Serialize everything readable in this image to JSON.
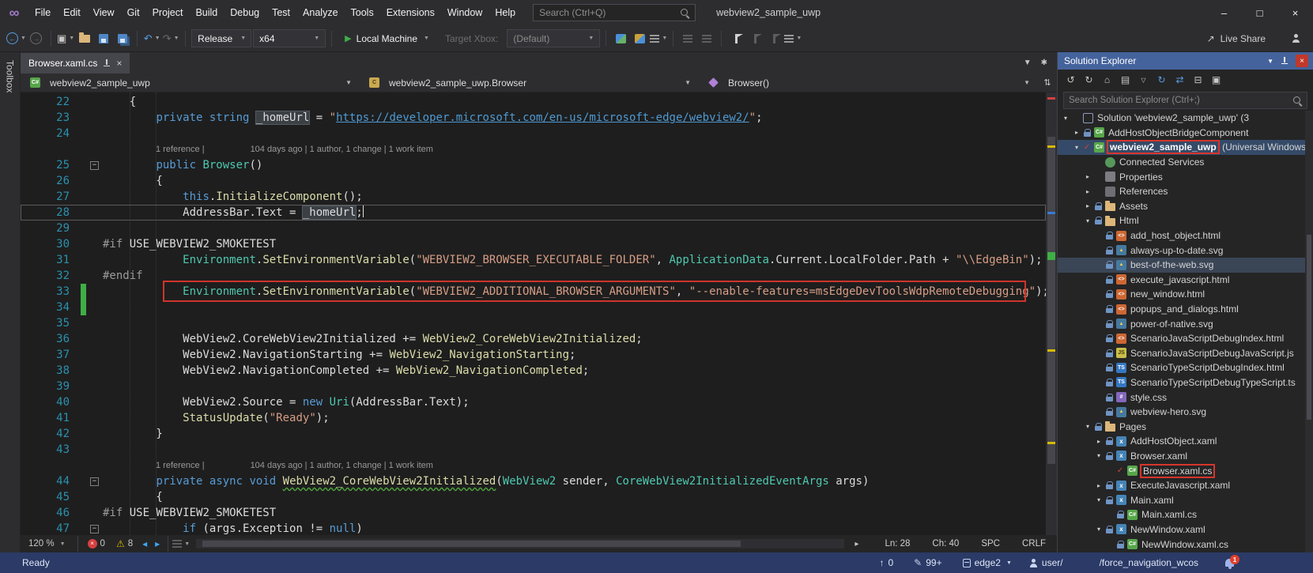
{
  "title_bar": {
    "menus": [
      "File",
      "Edit",
      "View",
      "Git",
      "Project",
      "Build",
      "Debug",
      "Test",
      "Analyze",
      "Tools",
      "Extensions",
      "Window",
      "Help"
    ],
    "search_placeholder": "Search (Ctrl+Q)",
    "window_title": "webview2_sample_uwp"
  },
  "toolbar": {
    "configuration": "Release",
    "platform": "x64",
    "start_button": "Local Machine",
    "target_xbox_label": "Target Xbox:",
    "device_dropdown": "(Default)",
    "live_share": "Live Share"
  },
  "toolbox_label": "Toolbox",
  "editor": {
    "tab_title": "Browser.xaml.cs",
    "nav_project": "webview2_sample_uwp",
    "nav_type": "webview2_sample_uwp.Browser",
    "nav_member": "Browser()",
    "codelens_left": "1 reference",
    "codelens_right": "104 days ago | 1 author, 1 change | 1 work item",
    "zoom": "120 %",
    "error_count": "0",
    "warning_count": "8",
    "line_indicator": "Ln: 28",
    "column_indicator": "Ch: 40",
    "space_indicator": "SPC",
    "eol_indicator": "CRLF",
    "code_lines": [
      {
        "n": "22",
        "segs": [
          [
            "pl",
            "    {"
          ]
        ]
      },
      {
        "n": "23",
        "segs": [
          [
            "pl",
            "        "
          ],
          [
            "kw",
            "private"
          ],
          [
            "pl",
            " "
          ],
          [
            "kw",
            "string"
          ],
          [
            "pl",
            " "
          ],
          [
            "ref",
            "_homeUrl"
          ],
          [
            "pl",
            " = "
          ],
          [
            "st",
            "\""
          ],
          [
            "url",
            "https://developer.microsoft.com/en-us/microsoft-edge/webview2/"
          ],
          [
            "st",
            "\""
          ],
          [
            "pl",
            ";"
          ]
        ]
      },
      {
        "n": "24",
        "segs": []
      },
      {
        "lens": true
      },
      {
        "n": "25",
        "fold": true,
        "segs": [
          [
            "pl",
            "        "
          ],
          [
            "kw",
            "public"
          ],
          [
            "pl",
            " "
          ],
          [
            "ty",
            "Browser"
          ],
          [
            "pl",
            "()"
          ]
        ]
      },
      {
        "n": "26",
        "segs": [
          [
            "pl",
            "        {"
          ]
        ]
      },
      {
        "n": "27",
        "segs": [
          [
            "pl",
            "            "
          ],
          [
            "kw",
            "this"
          ],
          [
            "pl",
            "."
          ],
          [
            "me",
            "InitializeComponent"
          ],
          [
            "pl",
            "();"
          ]
        ]
      },
      {
        "n": "28",
        "current": true,
        "caret": true,
        "segs": [
          [
            "pl",
            "            AddressBar.Text = "
          ],
          [
            "ref",
            "_homeUrl"
          ],
          [
            "pl",
            ";"
          ]
        ]
      },
      {
        "n": "29",
        "segs": []
      },
      {
        "n": "30",
        "segs": [
          [
            "pp",
            "#if"
          ],
          [
            "pl",
            " USE_WEBVIEW2_SMOKETEST"
          ]
        ]
      },
      {
        "n": "31",
        "segs": [
          [
            "pl",
            "            "
          ],
          [
            "ty",
            "Environment"
          ],
          [
            "pl",
            "."
          ],
          [
            "me",
            "SetEnvironmentVariable"
          ],
          [
            "pl",
            "("
          ],
          [
            "st",
            "\"WEBVIEW2_BROWSER_EXECUTABLE_FOLDER\""
          ],
          [
            "pl",
            ", "
          ],
          [
            "ty",
            "ApplicationData"
          ],
          [
            "pl",
            ".Current.LocalFolder.Path + "
          ],
          [
            "st",
            "\"\\\\EdgeBin\""
          ],
          [
            "pl",
            ");"
          ]
        ]
      },
      {
        "n": "32",
        "segs": [
          [
            "pp",
            "#endif"
          ]
        ]
      },
      {
        "n": "33",
        "changed": true,
        "annotated": true,
        "segs": [
          [
            "pl",
            "            "
          ],
          [
            "ty",
            "Environment"
          ],
          [
            "pl",
            "."
          ],
          [
            "me",
            "SetEnvironmentVariable"
          ],
          [
            "pl",
            "("
          ],
          [
            "st",
            "\"WEBVIEW2_ADDITIONAL_BROWSER_ARGUMENTS\""
          ],
          [
            "pl",
            ", "
          ],
          [
            "st",
            "\"--enable-features=msEdgeDevToolsWdpRemoteDebugging\""
          ],
          [
            "pl",
            ");"
          ]
        ]
      },
      {
        "n": "34",
        "changed": true,
        "segs": []
      },
      {
        "n": "35",
        "segs": []
      },
      {
        "n": "36",
        "segs": [
          [
            "pl",
            "            WebView2.CoreWebView2Initialized += "
          ],
          [
            "me",
            "WebView2_CoreWebView2Initialized"
          ],
          [
            "pl",
            ";"
          ]
        ]
      },
      {
        "n": "37",
        "segs": [
          [
            "pl",
            "            WebView2.NavigationStarting += "
          ],
          [
            "me",
            "WebView2_NavigationStarting"
          ],
          [
            "pl",
            ";"
          ]
        ]
      },
      {
        "n": "38",
        "segs": [
          [
            "pl",
            "            WebView2.NavigationCompleted += "
          ],
          [
            "me",
            "WebView2_NavigationCompleted"
          ],
          [
            "pl",
            ";"
          ]
        ]
      },
      {
        "n": "39",
        "segs": []
      },
      {
        "n": "40",
        "segs": [
          [
            "pl",
            "            WebView2.Source = "
          ],
          [
            "kw",
            "new"
          ],
          [
            "pl",
            " "
          ],
          [
            "ty",
            "Uri"
          ],
          [
            "pl",
            "(AddressBar.Text);"
          ]
        ]
      },
      {
        "n": "41",
        "segs": [
          [
            "pl",
            "            "
          ],
          [
            "me",
            "StatusUpdate"
          ],
          [
            "pl",
            "("
          ],
          [
            "st",
            "\"Ready\""
          ],
          [
            "pl",
            ");"
          ]
        ]
      },
      {
        "n": "42",
        "segs": [
          [
            "pl",
            "        }"
          ]
        ]
      },
      {
        "n": "43",
        "segs": []
      },
      {
        "lens": true
      },
      {
        "n": "44",
        "fold": true,
        "segs": [
          [
            "pl",
            "        "
          ],
          [
            "kw",
            "private"
          ],
          [
            "pl",
            " "
          ],
          [
            "kw",
            "async"
          ],
          [
            "pl",
            " "
          ],
          [
            "kw",
            "void"
          ],
          [
            "pl",
            " "
          ],
          [
            "mesq",
            "WebView2_CoreWebView2Initialized"
          ],
          [
            "pl",
            "("
          ],
          [
            "ty",
            "WebView2"
          ],
          [
            "pl",
            " sender, "
          ],
          [
            "ty",
            "CoreWebView2InitializedEventArgs"
          ],
          [
            "pl",
            " args)"
          ]
        ]
      },
      {
        "n": "45",
        "segs": [
          [
            "pl",
            "        {"
          ]
        ]
      },
      {
        "n": "46",
        "segs": [
          [
            "pp",
            "#if"
          ],
          [
            "pl",
            " USE_WEBVIEW2_SMOKETEST"
          ]
        ]
      },
      {
        "n": "47",
        "fold": true,
        "segs": [
          [
            "pl",
            "            "
          ],
          [
            "kw",
            "if"
          ],
          [
            "pl",
            " (args.Exception != "
          ],
          [
            "kw",
            "null"
          ],
          [
            "pl",
            ")"
          ]
        ]
      }
    ]
  },
  "solution_explorer": {
    "title": "Solution Explorer",
    "search_placeholder": "Search Solution Explorer (Ctrl+;)",
    "tree": [
      {
        "label": "Solution 'webview2_sample_uwp' (3",
        "icon": "solution",
        "indent": 0,
        "arrow": "open"
      },
      {
        "label": "AddHostObjectBridgeComponent",
        "icon": "csproj",
        "indent": 1,
        "arrow": "closed",
        "lock": true
      },
      {
        "label": "webview2_sample_uwp",
        "suffix": " (Universal Windows)",
        "icon": "csproj",
        "indent": 1,
        "arrow": "open",
        "check": true,
        "bold": true,
        "selected": true,
        "redbox": true
      },
      {
        "label": "Connected Services",
        "icon": "services",
        "indent": 2
      },
      {
        "label": "Properties",
        "icon": "properties",
        "indent": 2,
        "arrow": "closed"
      },
      {
        "label": "References",
        "icon": "references",
        "indent": 2,
        "arrow": "closed"
      },
      {
        "label": "Assets",
        "icon": "folder",
        "indent": 2,
        "arrow": "closed",
        "lock": true
      },
      {
        "label": "Html",
        "icon": "folder",
        "indent": 2,
        "arrow": "open",
        "lock": true
      },
      {
        "label": "add_host_object.html",
        "icon": "html",
        "indent": 3,
        "lock": true
      },
      {
        "label": "always-up-to-date.svg",
        "icon": "svg",
        "indent": 3,
        "lock": true
      },
      {
        "label": "best-of-the-web.svg",
        "icon": "svg",
        "indent": 3,
        "lock": true,
        "rowhl": true
      },
      {
        "label": "execute_javascript.html",
        "icon": "html",
        "indent": 3,
        "lock": true
      },
      {
        "label": "new_window.html",
        "icon": "html",
        "indent": 3,
        "lock": true
      },
      {
        "label": "popups_and_dialogs.html",
        "icon": "html",
        "indent": 3,
        "lock": true
      },
      {
        "label": "power-of-native.svg",
        "icon": "svg",
        "indent": 3,
        "lock": true
      },
      {
        "label": "ScenarioJavaScriptDebugIndex.html",
        "icon": "html",
        "indent": 3,
        "lock": true
      },
      {
        "label": "ScenarioJavaScriptDebugJavaScript.js",
        "icon": "js",
        "indent": 3,
        "lock": true
      },
      {
        "label": "ScenarioTypeScriptDebugIndex.html",
        "icon": "ts",
        "indent": 3,
        "lock": true
      },
      {
        "label": "ScenarioTypeScriptDebugTypeScript.ts",
        "icon": "ts",
        "indent": 3,
        "lock": true
      },
      {
        "label": "style.css",
        "icon": "css",
        "indent": 3,
        "lock": true
      },
      {
        "label": "webview-hero.svg",
        "icon": "svg",
        "indent": 3,
        "lock": true
      },
      {
        "label": "Pages",
        "icon": "folder",
        "indent": 2,
        "arrow": "open",
        "lock": true
      },
      {
        "label": "AddHostObject.xaml",
        "icon": "xaml",
        "indent": 3,
        "arrow": "closed",
        "lock": true
      },
      {
        "label": "Browser.xaml",
        "icon": "xaml",
        "indent": 3,
        "arrow": "open",
        "lock": true
      },
      {
        "label": "Browser.xaml.cs",
        "icon": "cs",
        "indent": 4,
        "check": true,
        "redbox": true
      },
      {
        "label": "ExecuteJavascript.xaml",
        "icon": "xaml",
        "indent": 3,
        "arrow": "closed",
        "lock": true
      },
      {
        "label": "Main.xaml",
        "icon": "xaml",
        "indent": 3,
        "arrow": "open",
        "lock": true
      },
      {
        "label": "Main.xaml.cs",
        "icon": "cs",
        "indent": 4,
        "lock": true
      },
      {
        "label": "NewWindow.xaml",
        "icon": "xaml",
        "indent": 3,
        "arrow": "open",
        "lock": true
      },
      {
        "label": "NewWindow.xaml.cs",
        "icon": "cs",
        "indent": 4,
        "lock": true
      }
    ]
  },
  "status_bar": {
    "ready": "Ready",
    "outgoing_commits": "0",
    "pending_edits": "99+",
    "repository": "edge2",
    "branch_prefix": "user/",
    "branch_suffix": "/force_navigation_wcos",
    "notifications": "1"
  },
  "colors": {
    "accent_blue": "#44639c",
    "annotation_red": "#cf342b",
    "keyword": "#569cd6",
    "type": "#4ec9b0",
    "string": "#d69d85",
    "method": "#dcdcaa",
    "line_number": "#2b91af",
    "change_bar_green": "#3fae46",
    "status_bar": "#2b3a66"
  },
  "icons": [
    "vs-logo",
    "search-icon",
    "minimize-icon",
    "maximize-icon",
    "close-icon",
    "navigate-backward-icon",
    "navigate-forward-icon",
    "new-project-icon",
    "open-file-icon",
    "save-icon",
    "save-all-icon",
    "undo-icon",
    "redo-icon",
    "start-icon",
    "bookmark-icon",
    "live-share-icon",
    "feedback-person-icon",
    "pin-icon",
    "csharp-project-icon",
    "class-icon",
    "method-icon",
    "error-icon",
    "warning-icon",
    "home-icon",
    "refresh-icon",
    "collapse-all-icon",
    "properties-icon",
    "lock-icon",
    "folder-icon",
    "bell-icon",
    "branch-repo-icon",
    "person-icon",
    "pencil-icon",
    "up-arrow-icon"
  ]
}
